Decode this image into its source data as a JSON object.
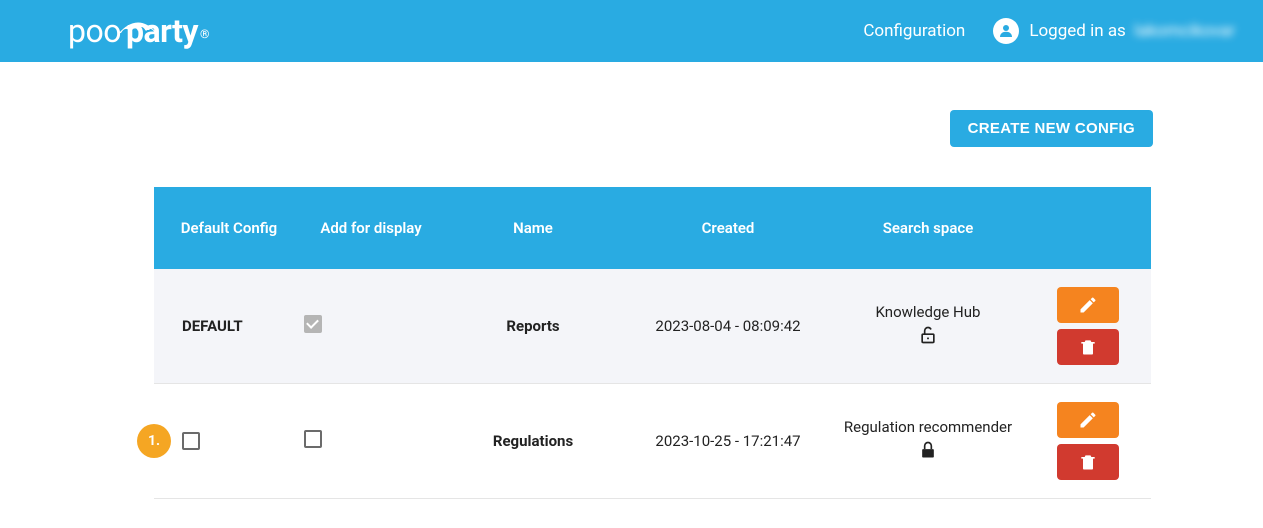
{
  "header": {
    "brand_pool": "poo",
    "brand_party": "party",
    "brand_reg": "®",
    "config_link": "Configuration",
    "logged_in_prefix": "Logged in as",
    "username": "lakomcikovar"
  },
  "actions": {
    "create_config": "CREATE NEW CONFIG"
  },
  "table": {
    "headers": {
      "default_config": "Default Config",
      "add_for_display": "Add for display",
      "name": "Name",
      "created": "Created",
      "search_space": "Search space"
    },
    "rows": [
      {
        "rank": "",
        "default_label": "DEFAULT",
        "display_checked_disabled": true,
        "name": "Reports",
        "created": "2023-08-04 - 08:09:42",
        "search_space": "Knowledge Hub",
        "locked": "unlocked"
      },
      {
        "rank": "1.",
        "default_label": "",
        "display_checked_disabled": false,
        "name": "Regulations",
        "created": "2023-10-25 - 17:21:47",
        "search_space": "Regulation recommender",
        "locked": "locked"
      }
    ]
  }
}
